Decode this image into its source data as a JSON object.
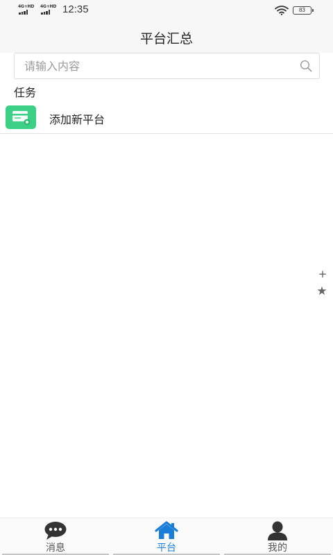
{
  "status_bar": {
    "signal_1_label": "4G+HD",
    "signal_2_label": "4G+HD",
    "time": "12:35",
    "battery": "83"
  },
  "header": {
    "title": "平台汇总"
  },
  "search": {
    "placeholder": "请输入内容",
    "value": ""
  },
  "section": {
    "label": "任务"
  },
  "list": {
    "items": [
      {
        "label": "添加新平台",
        "icon": "platform-card-icon",
        "icon_color": "#3ccf86"
      }
    ]
  },
  "side_controls": {
    "plus": "+",
    "star": "★"
  },
  "bottom_nav": {
    "active_color": "#1a7ed8",
    "tabs": [
      {
        "label": "消息",
        "icon": "chat-bubble-icon"
      },
      {
        "label": "平台",
        "icon": "home-icon"
      },
      {
        "label": "我的",
        "icon": "user-icon"
      }
    ]
  }
}
